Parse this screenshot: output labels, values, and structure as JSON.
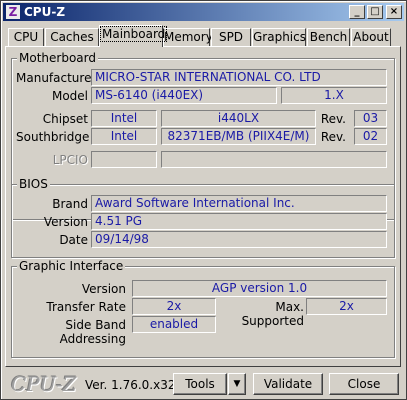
{
  "window": {
    "title": "CPU-Z",
    "icon_letter": "Z"
  },
  "titlebar_buttons": {
    "minimize": "_",
    "maximize": "□",
    "close": "×"
  },
  "tabs": [
    "CPU",
    "Caches",
    "Mainboard",
    "Memory",
    "SPD",
    "Graphics",
    "Bench",
    "About"
  ],
  "active_tab": "Mainboard",
  "motherboard": {
    "title": "Motherboard",
    "manufacturer_label": "Manufacturer",
    "manufacturer": "MICRO-STAR INTERNATIONAL CO. LTD",
    "model_label": "Model",
    "model": "MS-6140 (i440EX)",
    "model_rev": "1.X",
    "chipset_label": "Chipset",
    "chipset_vendor": "Intel",
    "chipset_name": "i440LX",
    "chipset_rev_label": "Rev.",
    "chipset_rev": "03",
    "southbridge_label": "Southbridge",
    "southbridge_vendor": "Intel",
    "southbridge_name": "82371EB/MB (PIIX4E/M)",
    "southbridge_rev_label": "Rev.",
    "southbridge_rev": "02",
    "lpcio_label": "LPCIO"
  },
  "bios": {
    "title": "BIOS",
    "brand_label": "Brand",
    "brand": "Award Software International Inc.",
    "version_label": "Version",
    "version": "4.51 PG",
    "date_label": "Date",
    "date": "09/14/98"
  },
  "graphic": {
    "title": "Graphic Interface",
    "version_label": "Version",
    "version": "AGP version 1.0",
    "transfer_label": "Transfer Rate",
    "transfer": "2x",
    "max_label": "Max. Supported",
    "max": "2x",
    "sba_label": "Side Band Addressing",
    "sba": "enabled"
  },
  "footer": {
    "logo": "CPU-Z",
    "version": "Ver. 1.76.0.x32",
    "tools_label": "Tools",
    "tools_arrow": "▼",
    "validate_label": "Validate",
    "close_label": "Close"
  }
}
